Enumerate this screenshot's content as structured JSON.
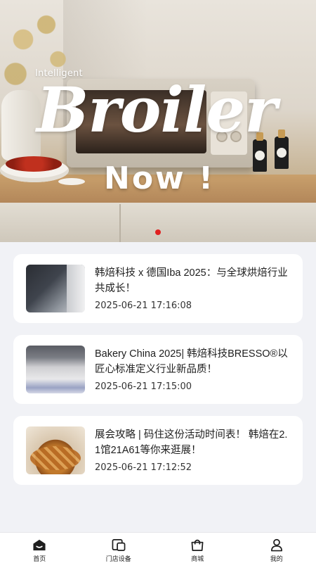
{
  "banner": {
    "small_text": "Intelligent",
    "title": "Broiler",
    "subtitle": "Now !",
    "pager": {
      "count": 1,
      "active": 0,
      "active_color": "#e02020"
    }
  },
  "news": [
    {
      "thumb": "expo-booth-photo",
      "title": "韩焙科技 x 德国Iba 2025：与全球烘焙行业共成长！",
      "time": "2025-06-21 17:16:08"
    },
    {
      "thumb": "exhibition-hall-photo",
      "title": "Bakery China 2025| 韩焙科技BRESSO®以匠心标准定义行业新品质！",
      "time": "2025-06-21 17:15:00"
    },
    {
      "thumb": "baked-pie-photo",
      "title": "展会攻略 | 码住这份活动时间表！ 韩焙在2.1馆21A61等你来逛展！",
      "time": "2025-06-21 17:12:52"
    }
  ],
  "tabbar": {
    "items": [
      {
        "label": "首页",
        "icon": "home-icon",
        "active": true
      },
      {
        "label": "门店设备",
        "icon": "devices-icon",
        "active": false
      },
      {
        "label": "商城",
        "icon": "shopping-bag-icon",
        "active": false
      },
      {
        "label": "我的",
        "icon": "profile-icon",
        "active": false
      }
    ]
  },
  "colors": {
    "page_bg": "#f1f2f6",
    "card_bg": "#ffffff",
    "accent": "#e02020",
    "text": "#1e1e1e"
  }
}
